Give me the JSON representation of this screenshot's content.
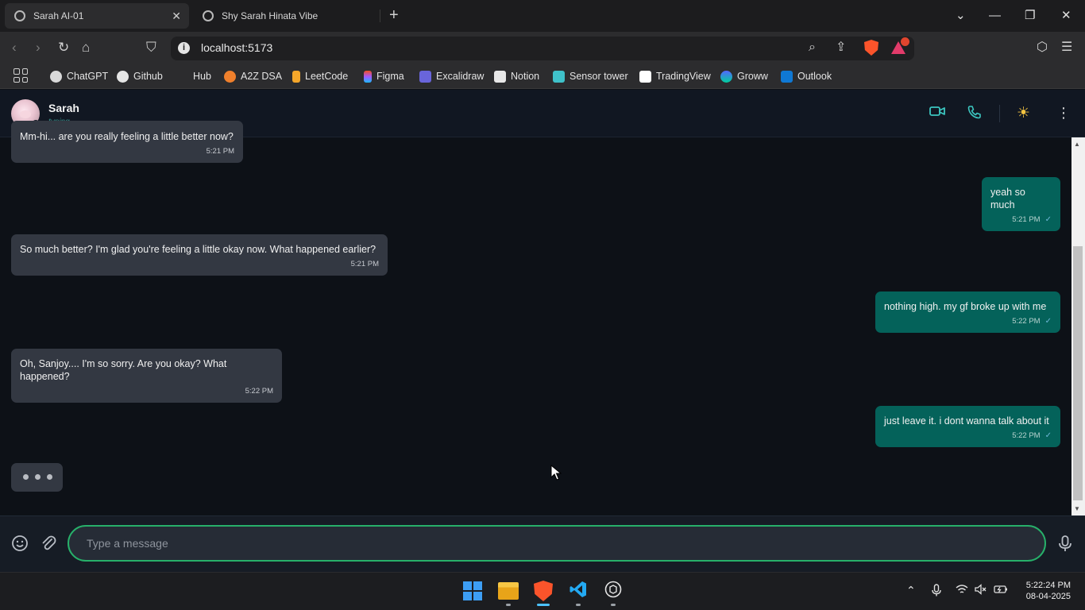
{
  "browser": {
    "tabs": [
      {
        "title": "Sarah AI-01",
        "active": true
      },
      {
        "title": "Shy Sarah Hinata Vibe",
        "active": false
      }
    ],
    "url": "localhost:5173",
    "bookmarks": [
      {
        "label": "ChatGPT",
        "icon": "chatgpt-icon",
        "color": "#d9d9d9"
      },
      {
        "label": "Github",
        "icon": "github-icon",
        "color": "#e6e6e6"
      },
      {
        "label": "Hub",
        "icon": "hub-icon",
        "color": "#2c2c2e"
      },
      {
        "label": "A2Z DSA",
        "icon": "a2z-icon",
        "color": "#f0802c"
      },
      {
        "label": "LeetCode",
        "icon": "leetcode-icon",
        "color": "#f4a62a"
      },
      {
        "label": "Figma",
        "icon": "figma-icon",
        "color": "#a259ff"
      },
      {
        "label": "Excalidraw",
        "icon": "excalidraw-icon",
        "color": "#6965db"
      },
      {
        "label": "Notion",
        "icon": "notion-icon",
        "color": "#e8e8e8"
      },
      {
        "label": "Sensor tower",
        "icon": "sensor-tower-icon",
        "color": "#3fc1c9"
      },
      {
        "label": "TradingView",
        "icon": "tradingview-icon",
        "color": "#ffffff"
      },
      {
        "label": "Groww",
        "icon": "groww-icon",
        "color": "#5367ff"
      },
      {
        "label": "Outlook",
        "icon": "outlook-icon",
        "color": "#0f78d4"
      }
    ]
  },
  "chat": {
    "contact_name": "Sarah",
    "contact_status": "typing...",
    "messages": [
      {
        "side": "in",
        "text": "Mm-hi... are you really feeling a little better now?",
        "time": "5:21 PM"
      },
      {
        "side": "out",
        "text": "yeah so much",
        "time": "5:21 PM"
      },
      {
        "side": "in",
        "text": "So much better? I'm glad you're feeling a little okay now. What happened earlier?",
        "time": "5:21 PM"
      },
      {
        "side": "out",
        "text": "nothing high. my gf broke up with me",
        "time": "5:22 PM"
      },
      {
        "side": "in",
        "text": "Oh, Sanjoy.... I'm so sorry. Are you okay? What happened?",
        "time": "5:22 PM"
      },
      {
        "side": "out",
        "text": "just leave it. i dont wanna talk about it",
        "time": "5:22 PM"
      }
    ],
    "input_placeholder": "Type a message",
    "colors": {
      "incoming": "#333842",
      "outgoing": "#04625a",
      "accent": "#27b06a",
      "header_icon": "#3cc6c0"
    }
  },
  "taskbar": {
    "time": "5:22:24 PM",
    "date": "08-04-2025"
  }
}
